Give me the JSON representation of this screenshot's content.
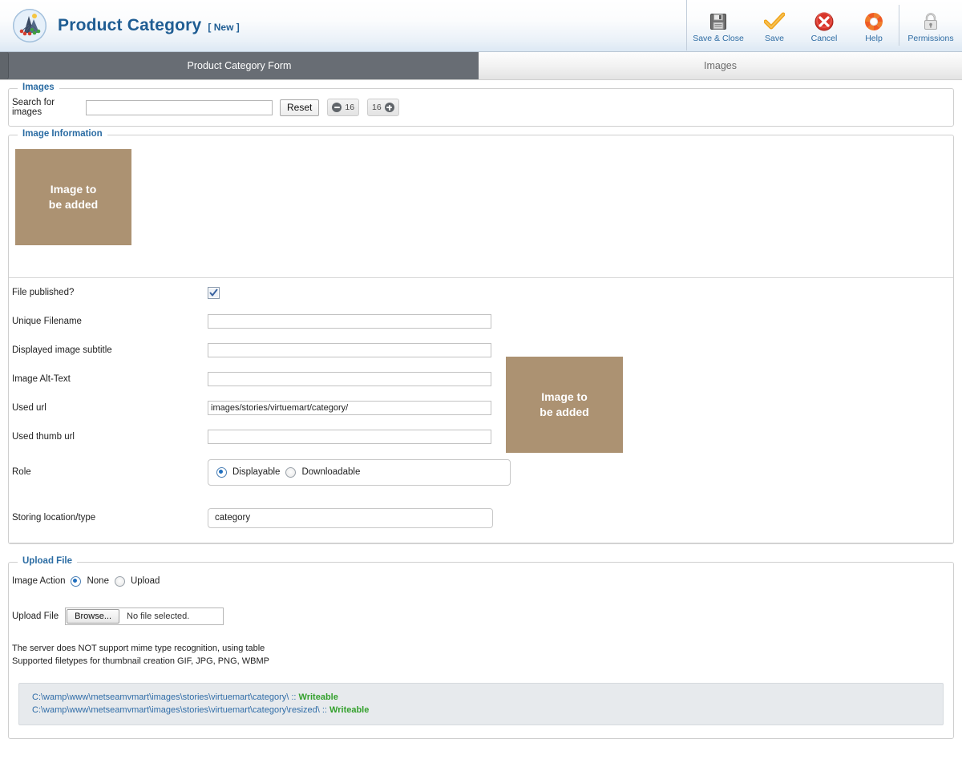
{
  "header": {
    "logo_icon": "virtuemart-logo-icon",
    "title": "Product Category",
    "state": "[ New ]"
  },
  "toolbar": {
    "buttons": [
      {
        "label": "Save & Close",
        "icon": "floppy-disk-icon"
      },
      {
        "label": "Save",
        "icon": "checkmark-icon"
      },
      {
        "label": "Cancel",
        "icon": "cancel-circle-icon"
      },
      {
        "label": "Help",
        "icon": "lifebuoy-icon"
      },
      {
        "label": "Permissions",
        "icon": "padlock-icon"
      }
    ]
  },
  "tabs": [
    {
      "label": "Product Category Form",
      "active": true
    },
    {
      "label": "Images",
      "active": false
    }
  ],
  "images_panel": {
    "legend": "Images",
    "search_label": "Search for images",
    "search_value": "",
    "search_placeholder": "",
    "reset_label": "Reset",
    "stepper_decrease": {
      "icon": "minus-circle-icon",
      "value": "16"
    },
    "stepper_increase": {
      "icon": "plus-circle-icon",
      "value": "16"
    }
  },
  "image_information": {
    "legend": "Image Information",
    "preview_large": "Image to\nbe added",
    "preview_large_line1": "Image to",
    "preview_large_line2": "be added",
    "preview_small_line1": "Image to",
    "preview_small_line2": "be added",
    "fields": {
      "file_published_label": "File published?",
      "file_published_checked": true,
      "unique_filename_label": "Unique Filename",
      "unique_filename_value": "",
      "subtitle_label": "Displayed image subtitle",
      "subtitle_value": "",
      "alt_text_label": "Image Alt-Text",
      "alt_text_value": "",
      "used_url_label": "Used url",
      "used_url_value": "images/stories/virtuemart/category/",
      "used_thumb_url_label": "Used thumb url",
      "used_thumb_url_value": "",
      "role_label": "Role",
      "role_options": [
        "Displayable",
        "Downloadable"
      ],
      "role_selected": "Displayable",
      "storing_label": "Storing location/type",
      "storing_value": "category"
    }
  },
  "upload_file": {
    "legend": "Upload File",
    "image_action_label": "Image Action",
    "image_action_options": [
      "None",
      "Upload"
    ],
    "image_action_selected": "None",
    "upload_file_label": "Upload File",
    "browse_label": "Browse...",
    "file_status": "No file selected.",
    "note_line1": "The server does NOT support mime type recognition, using table",
    "note_line2": "Supported filetypes for thumbnail creation GIF, JPG, PNG, WBMP",
    "messages": [
      {
        "path": "C:\\wamp\\www\\metseamvmart\\images\\stories\\virtuemart\\category\\ :: ",
        "status": "Writeable"
      },
      {
        "path": "C:\\wamp\\www\\metseamvmart\\images\\stories\\virtuemart\\category\\resized\\ :: ",
        "status": "Writeable"
      }
    ]
  },
  "colors": {
    "accent_blue": "#2b6ca3",
    "title_blue": "#1f5d93",
    "placeholder_tan": "#ac9272",
    "tab_active_bg": "#686d74",
    "writeable_green": "#33a02c",
    "message_bg": "#e7eaed"
  }
}
